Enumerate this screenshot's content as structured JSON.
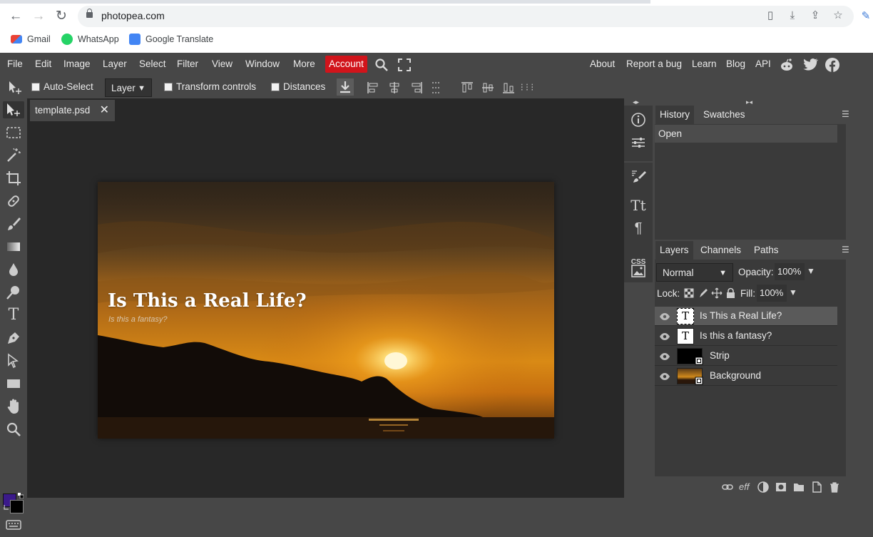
{
  "browser": {
    "url": "photopea.com",
    "bookmarks": [
      "Gmail",
      "WhatsApp",
      "Google Translate"
    ]
  },
  "menu": {
    "items": [
      "File",
      "Edit",
      "Image",
      "Layer",
      "Select",
      "Filter",
      "View",
      "Window",
      "More"
    ],
    "account": "Account",
    "right_links": [
      "About",
      "Report a bug",
      "Learn",
      "Blog",
      "API"
    ]
  },
  "options": {
    "auto_select": "Auto-Select",
    "select_value": "Layer",
    "transform_controls": "Transform controls",
    "distances": "Distances"
  },
  "document": {
    "tab_name": "template.psd",
    "title_text": "Is This a Real Life?",
    "subtitle_text": "Is this a fantasy?"
  },
  "history_panel": {
    "tabs": [
      "History",
      "Swatches"
    ],
    "entries": [
      "Open"
    ]
  },
  "layers_panel": {
    "tabs": [
      "Layers",
      "Channels",
      "Paths"
    ],
    "blend_mode": "Normal",
    "opacity_label": "Opacity:",
    "opacity_value": "100%",
    "lock_label": "Lock:",
    "fill_label": "Fill:",
    "fill_value": "100%",
    "layers": [
      {
        "name": "Is This a Real Life?",
        "type": "text"
      },
      {
        "name": "Is this a fantasy?",
        "type": "text"
      },
      {
        "name": "Strip",
        "type": "smart"
      },
      {
        "name": "Background",
        "type": "smart"
      }
    ],
    "footer_eff": "eff"
  },
  "colors": {
    "accent_account": "#d1141b",
    "foreground": "#3b1a8a",
    "background_color": "#000000"
  }
}
